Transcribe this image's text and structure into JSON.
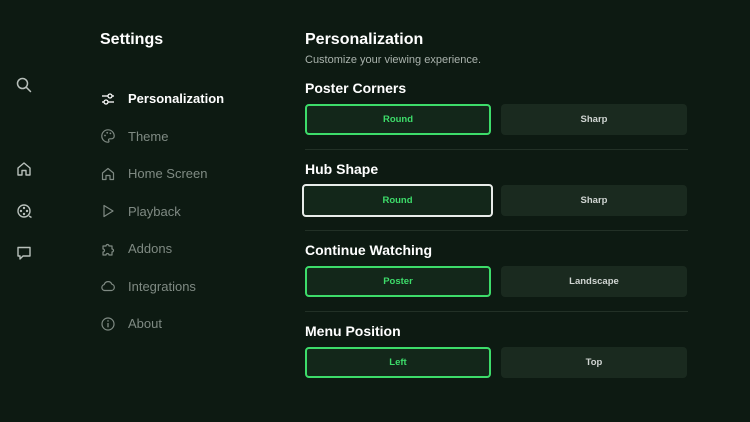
{
  "rail": {
    "icons": [
      "search-icon",
      "home-icon",
      "movie-reel-icon",
      "chat-icon"
    ]
  },
  "sidebar": {
    "title": "Settings",
    "items": [
      {
        "label": "Personalization",
        "icon": "sliders-icon",
        "active": true
      },
      {
        "label": "Theme",
        "icon": "palette-icon",
        "active": false
      },
      {
        "label": "Home Screen",
        "icon": "home-icon",
        "active": false
      },
      {
        "label": "Playback",
        "icon": "play-icon",
        "active": false
      },
      {
        "label": "Addons",
        "icon": "puzzle-icon",
        "active": false
      },
      {
        "label": "Integrations",
        "icon": "cloud-icon",
        "active": false
      },
      {
        "label": "About",
        "icon": "info-icon",
        "active": false
      }
    ]
  },
  "main": {
    "heading": "Personalization",
    "subheading": "Customize your viewing experience.",
    "sections": [
      {
        "title": "Poster Corners",
        "options": [
          "Round",
          "Sharp"
        ],
        "selected": "Round"
      },
      {
        "title": "Hub Shape",
        "options": [
          "Round",
          "Sharp"
        ],
        "selected": "Round",
        "focused": "Round"
      },
      {
        "title": "Continue Watching",
        "options": [
          "Poster",
          "Landscape"
        ],
        "selected": "Poster"
      },
      {
        "title": "Menu Position",
        "options": [
          "Left",
          "Top"
        ],
        "selected": "Left"
      }
    ]
  },
  "colors": {
    "background": "#0d1a12",
    "accent": "#3ddc6a",
    "option_bg": "#1a2a1f",
    "focus_border": "#e8ece9",
    "muted_text": "#7f8a83"
  }
}
